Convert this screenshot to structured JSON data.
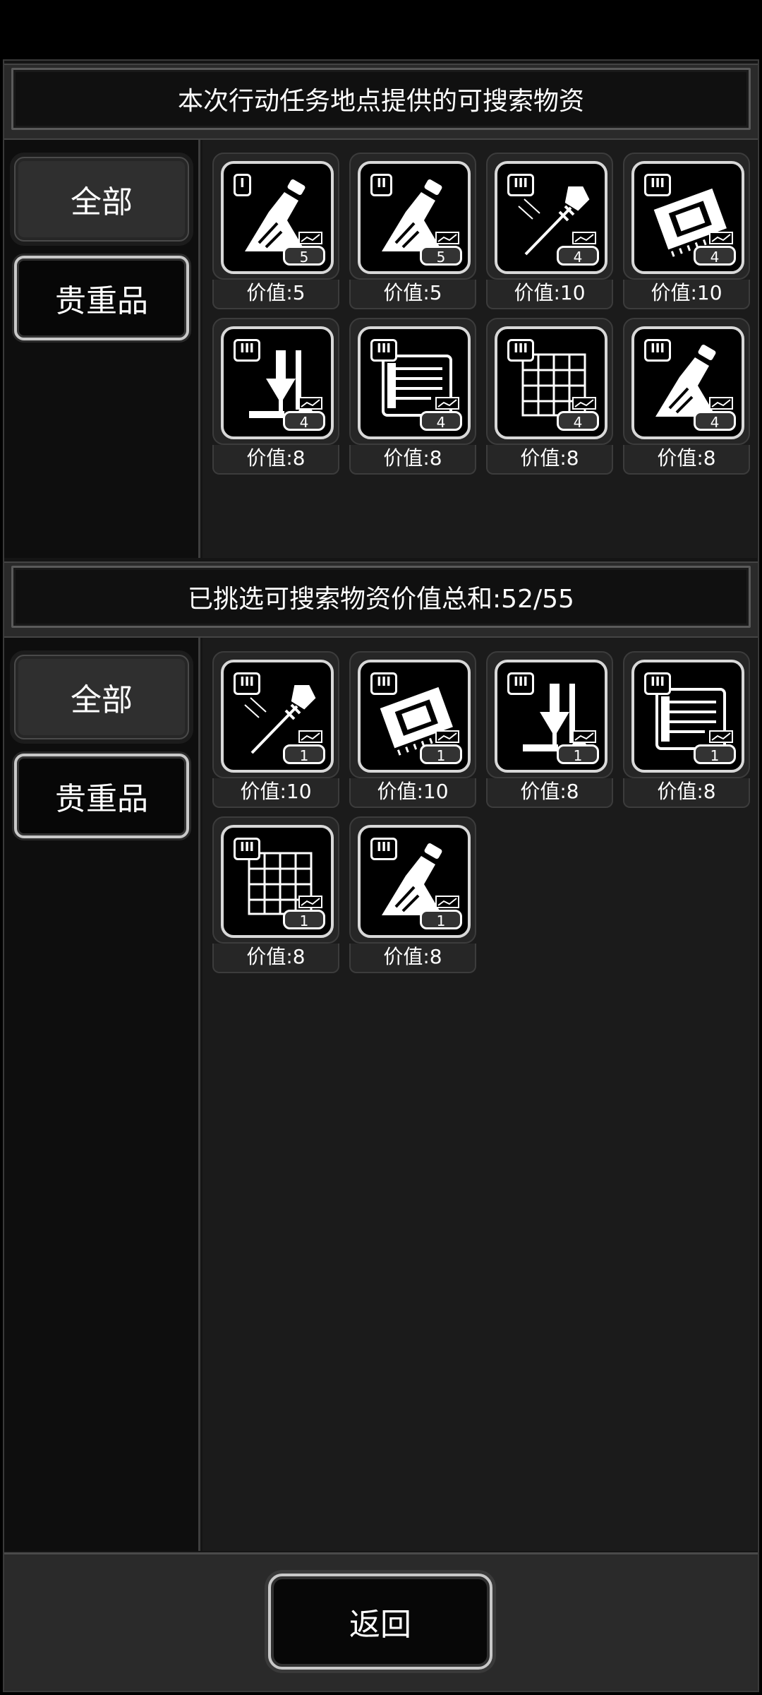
{
  "top_panel": {
    "title": "本次行动任务地点提供的可搜索物资",
    "tabs": {
      "all": "全部",
      "valuable": "贵重品"
    },
    "items": [
      {
        "tier": "I",
        "icon": "flask-icon",
        "count": "5",
        "value": "价值:5"
      },
      {
        "tier": "II",
        "icon": "flask-icon",
        "count": "5",
        "value": "价值:5"
      },
      {
        "tier": "III",
        "icon": "syringe-icon",
        "count": "4",
        "value": "价值:10"
      },
      {
        "tier": "III",
        "icon": "chip-icon",
        "count": "4",
        "value": "价值:10"
      },
      {
        "tier": "III",
        "icon": "lab-equipment-icon",
        "count": "4",
        "value": "价值:8"
      },
      {
        "tier": "III",
        "icon": "circuit-board-icon",
        "count": "4",
        "value": "价值:8"
      },
      {
        "tier": "III",
        "icon": "grid-panel-icon",
        "count": "4",
        "value": "价值:8"
      },
      {
        "tier": "III",
        "icon": "flask-icon",
        "count": "4",
        "value": "价值:8"
      }
    ]
  },
  "bottom_panel": {
    "title": "已挑选可搜索物资价值总和:52/55",
    "tabs": {
      "all": "全部",
      "valuable": "贵重品"
    },
    "items": [
      {
        "tier": "III",
        "icon": "syringe-icon",
        "count": "1",
        "value": "价值:10"
      },
      {
        "tier": "III",
        "icon": "chip-icon",
        "count": "1",
        "value": "价值:10"
      },
      {
        "tier": "III",
        "icon": "lab-equipment-icon",
        "count": "1",
        "value": "价值:8"
      },
      {
        "tier": "III",
        "icon": "circuit-board-icon",
        "count": "1",
        "value": "价值:8"
      },
      {
        "tier": "III",
        "icon": "grid-panel-icon",
        "count": "1",
        "value": "价值:8"
      },
      {
        "tier": "III",
        "icon": "flask-icon",
        "count": "1",
        "value": "价值:8"
      }
    ]
  },
  "footer": {
    "return_label": "返回"
  }
}
